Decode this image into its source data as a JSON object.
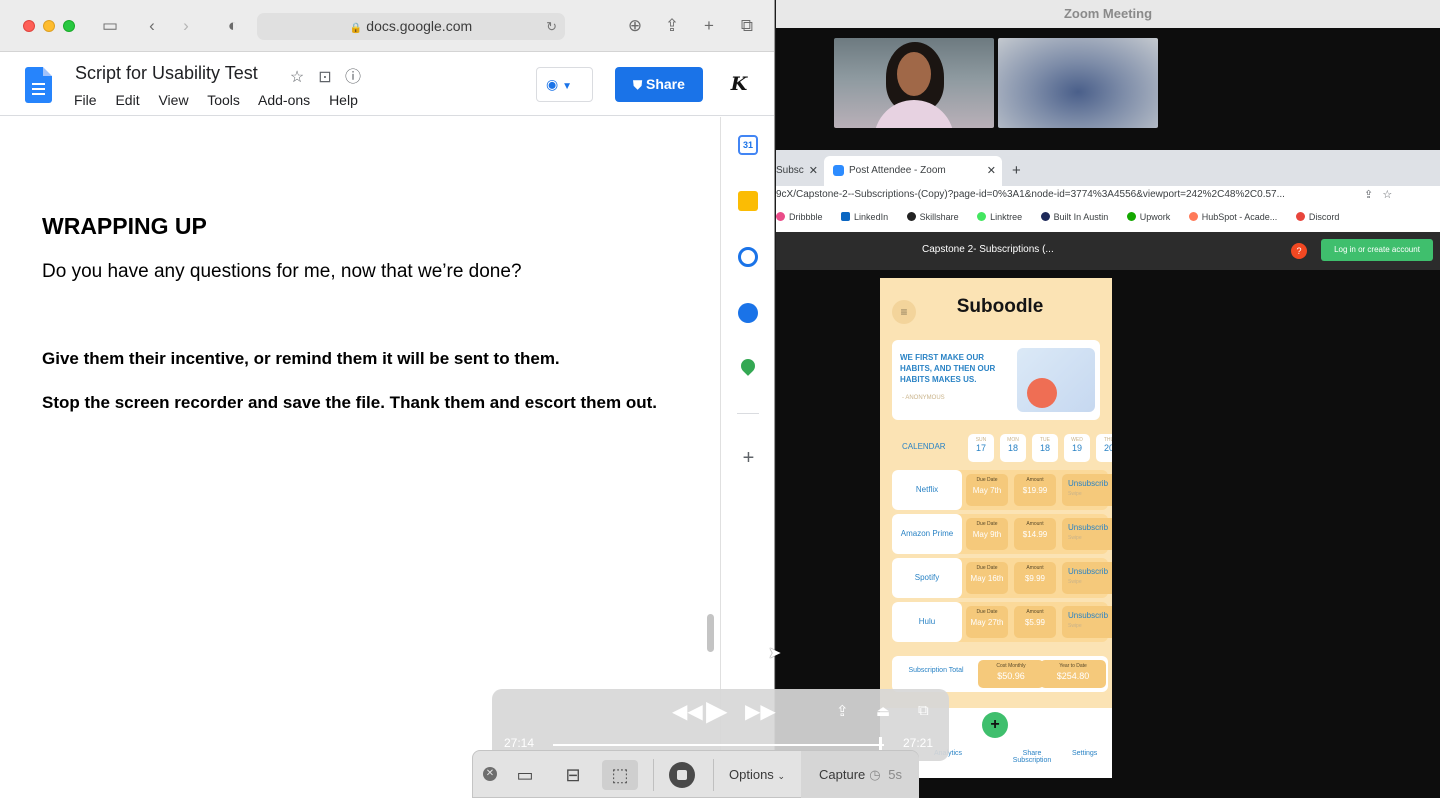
{
  "safari": {
    "address": "docs.google.com",
    "doc_title": "Script for Usability Test",
    "menu": [
      "File",
      "Edit",
      "View",
      "Tools",
      "Add-ons",
      "Help"
    ],
    "share_label": "Share",
    "avatar_letter": "K",
    "calendar_day": "31"
  },
  "doc": {
    "heading": "WRAPPING UP",
    "question": "Do you have any questions for me, now that we’re done?",
    "instruction_1": "Give them their incentive, or remind them it will be sent to them.",
    "instruction_2": "Stop the screen recorder and save the file.  Thank them and escort them out."
  },
  "zoom": {
    "title": "Zoom Meeting",
    "chrome_tab_1": "Subsc",
    "chrome_tab_2": "Post Attendee - Zoom",
    "url": "9cX/Capstone-2--Subscriptions-(Copy)?page-id=0%3A1&node-id=3774%3A4556&viewport=242%2C48%2C0.57...",
    "bookmarks": [
      "Dribbble",
      "LinkedIn",
      "Skillshare",
      "Linktree",
      "Built In Austin",
      "Upwork",
      "HubSpot - Acade...",
      "Discord"
    ],
    "figma_title": "Capstone 2- Subscriptions (...",
    "help": "?",
    "login": "Log in or create account"
  },
  "phone": {
    "logo": "Suboodle",
    "quote": "WE FIRST MAKE OUR HABITS, AND THEN OUR HABITS MAKES US.",
    "quote_author": "- ANONYMOUS",
    "calendar_label": "CALENDAR",
    "days": [
      {
        "dow": "SUN",
        "num": "17"
      },
      {
        "dow": "MON",
        "num": "18"
      },
      {
        "dow": "TUE",
        "num": "18"
      },
      {
        "dow": "WED",
        "num": "19"
      },
      {
        "dow": "THU",
        "num": "20"
      }
    ],
    "due_label": "Due Date",
    "amount_label": "Amount",
    "unsub_label": "Unsubscrib",
    "swipe_label": "Swipe",
    "subs": [
      {
        "name": "Netflix",
        "due": "May 7th",
        "amount": "$19.99"
      },
      {
        "name": "Amazon Prime",
        "due": "May 9th",
        "amount": "$14.99"
      },
      {
        "name": "Spotify",
        "due": "May 16th",
        "amount": "$9.99"
      },
      {
        "name": "Hulu",
        "due": "May 27th",
        "amount": "$5.99"
      }
    ],
    "total_label": "Subscription Total",
    "cost_monthly_label": "Cost Monthly",
    "cost_monthly": "$50.96",
    "ytd_label": "Year to Date",
    "ytd": "$254.80",
    "nav": [
      "Analytics",
      "Share Subscription",
      "Settings"
    ]
  },
  "player": {
    "elapsed": "27:14",
    "total": "27:21",
    "progress": 0.99
  },
  "capture_bar": {
    "options_label": "Options",
    "capture_label": "Capture",
    "timer": "5s"
  }
}
